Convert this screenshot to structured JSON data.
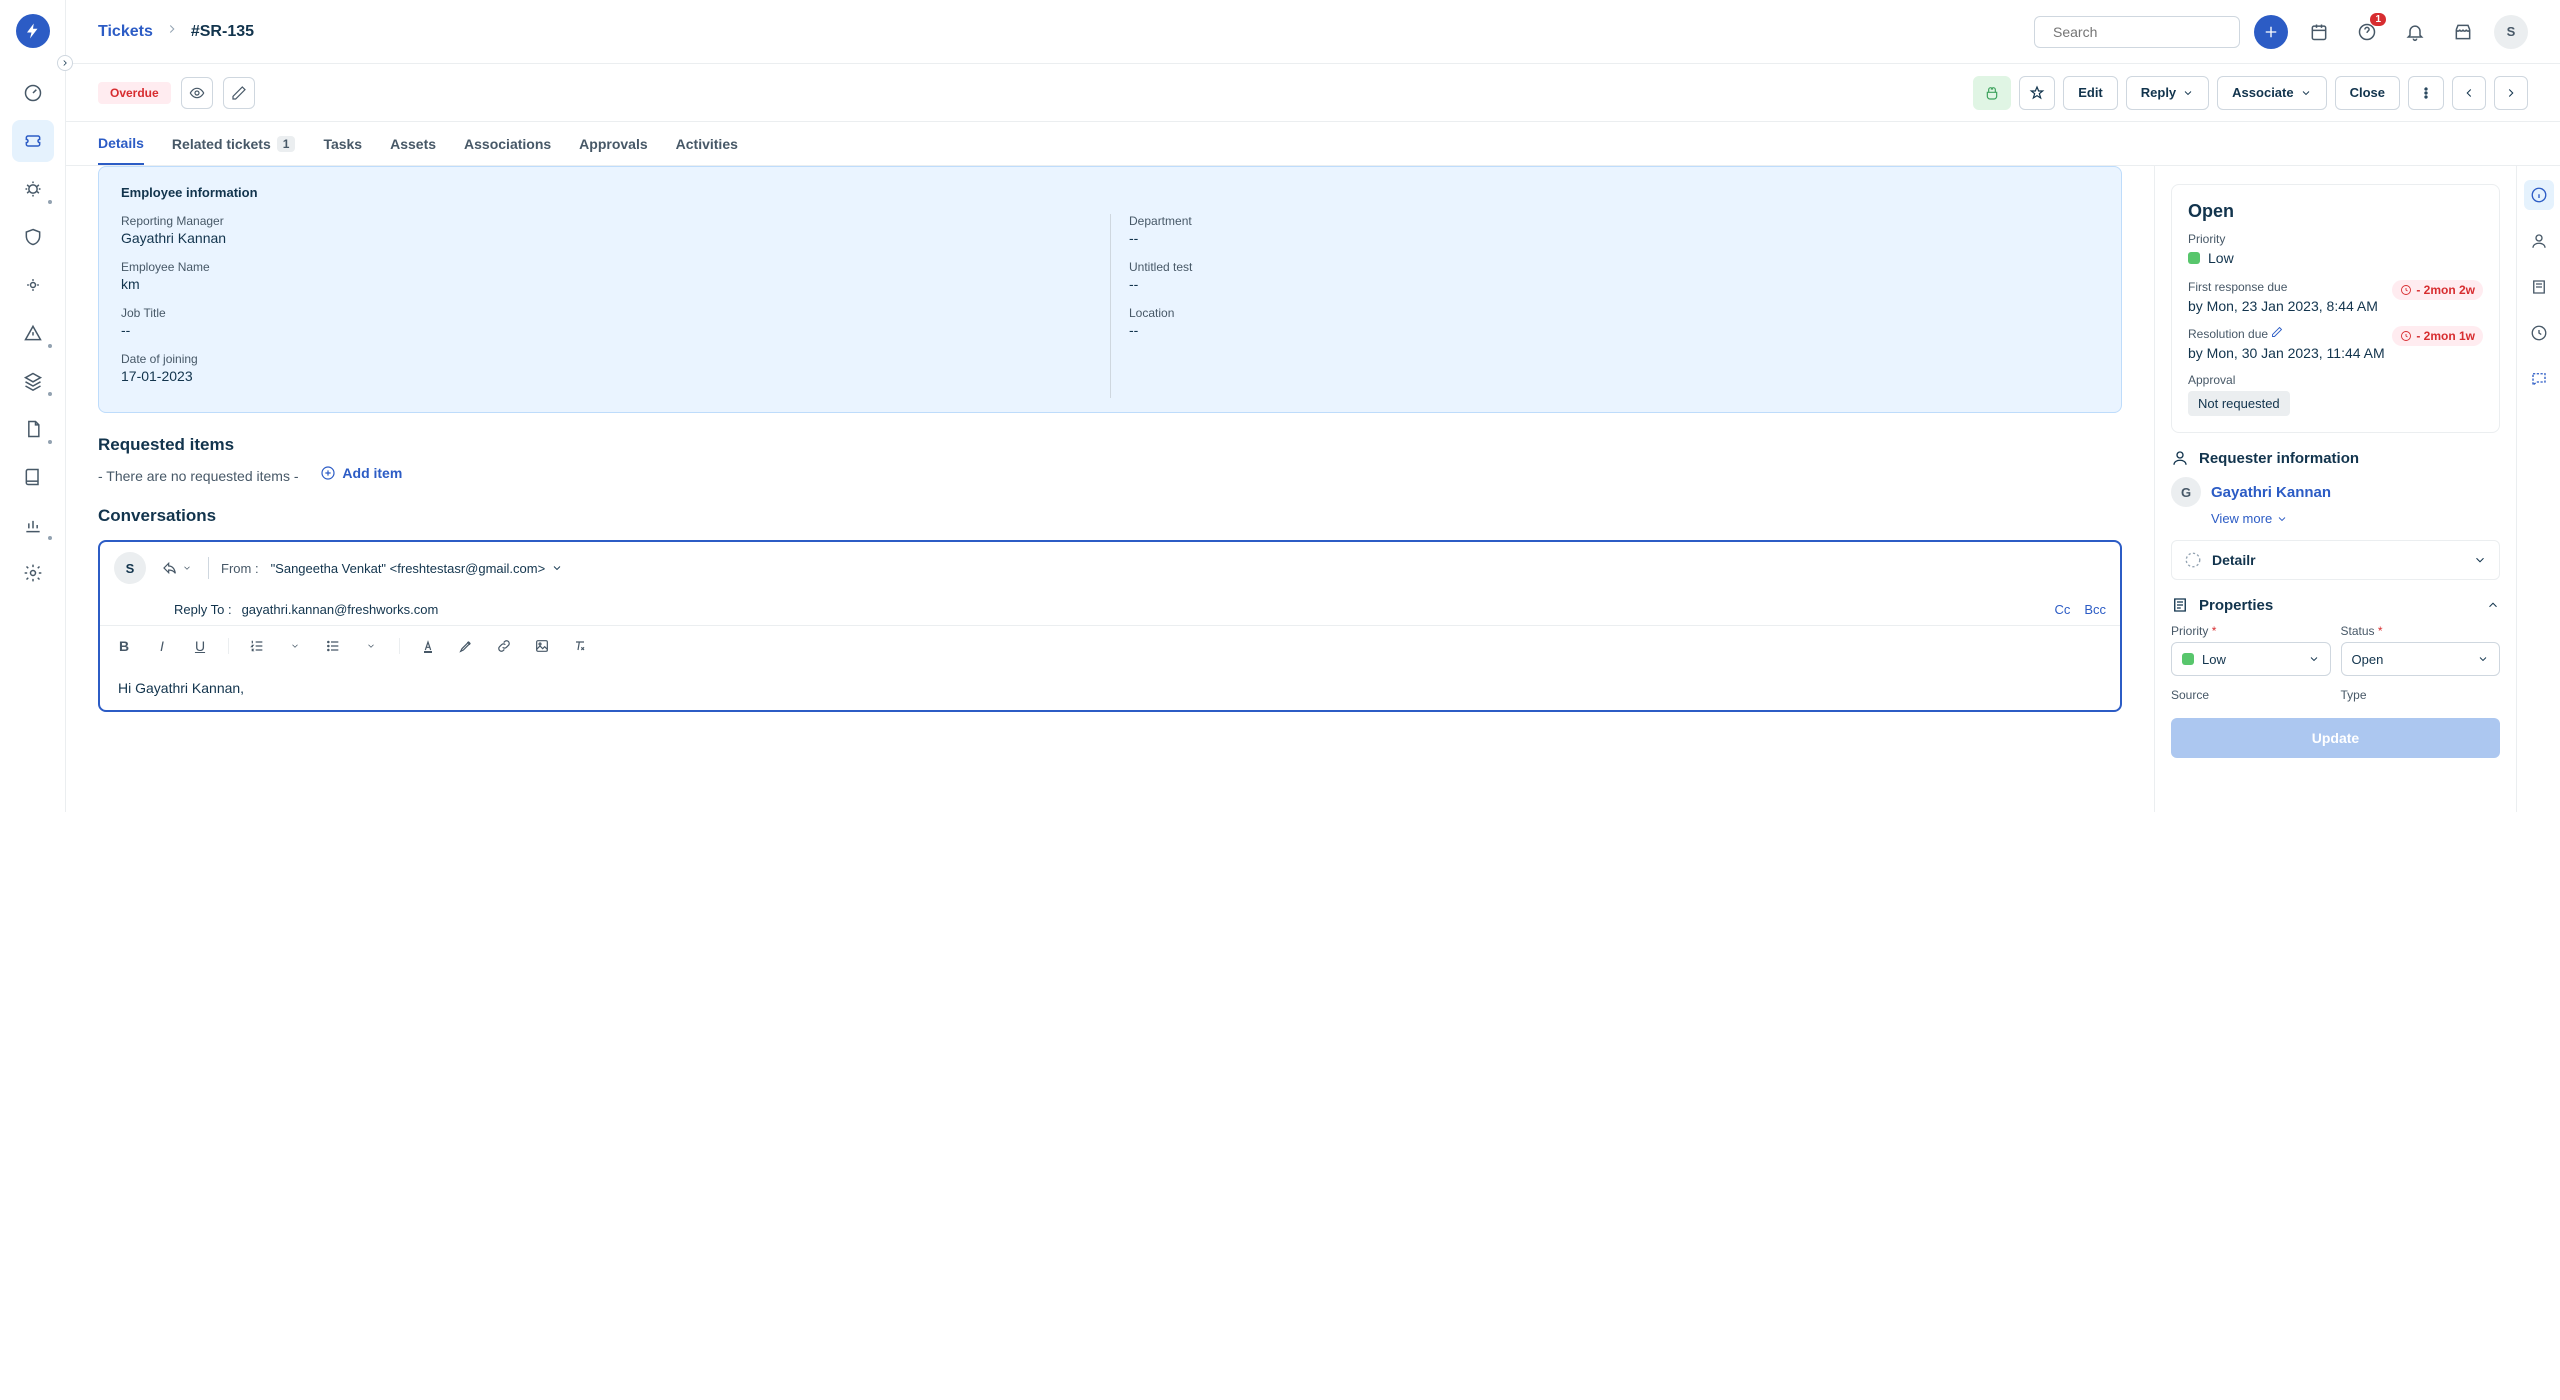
{
  "breadcrumb": {
    "root": "Tickets",
    "current": "#SR-135"
  },
  "search": {
    "placeholder": "Search"
  },
  "notif_count": "1",
  "avatar_initial": "S",
  "badges": {
    "overdue": "Overdue"
  },
  "actions": {
    "edit": "Edit",
    "reply": "Reply",
    "associate": "Associate",
    "close": "Close"
  },
  "tabs": {
    "details": "Details",
    "related": "Related tickets",
    "related_count": "1",
    "tasks": "Tasks",
    "assets": "Assets",
    "associations": "Associations",
    "approvals": "Approvals",
    "activities": "Activities"
  },
  "employee_info": {
    "title": "Employee information",
    "reporting_manager_label": "Reporting Manager",
    "reporting_manager": "Gayathri Kannan",
    "department_label": "Department",
    "department": "--",
    "employee_name_label": "Employee Name",
    "employee_name": "km",
    "untitled_label": "Untitled test",
    "untitled": "--",
    "job_title_label": "Job Title",
    "job_title": "--",
    "location_label": "Location",
    "location": "--",
    "doj_label": "Date of joining",
    "doj": "17-01-2023"
  },
  "requested": {
    "title": "Requested items",
    "empty": "- There are no requested items -",
    "add": "Add item"
  },
  "conversations": {
    "title": "Conversations"
  },
  "composer": {
    "avatar": "S",
    "from_label": "From :",
    "from_value": "\"Sangeetha Venkat\" <freshtestasr@gmail.com>",
    "reply_to_label": "Reply To :",
    "reply_to_value": "gayathri.kannan@freshworks.com",
    "cc": "Cc",
    "bcc": "Bcc",
    "body": "Hi Gayathri Kannan,"
  },
  "side": {
    "status": "Open",
    "priority_label": "Priority",
    "priority_value": "Low",
    "first_response_label": "First response due",
    "first_response_value": "by Mon, 23 Jan 2023, 8:44 AM",
    "first_response_overdue": "- 2mon 2w",
    "resolution_label": "Resolution due",
    "resolution_value": "by Mon, 30 Jan 2023, 11:44 AM",
    "resolution_overdue": "- 2mon 1w",
    "approval_label": "Approval",
    "approval_value": "Not requested",
    "requester_title": "Requester information",
    "requester_initial": "G",
    "requester_name": "Gayathri Kannan",
    "view_more": "View more",
    "detailr": "Detailr",
    "properties_title": "Properties",
    "prio_field_label": "Priority",
    "prio_field_value": "Low",
    "status_field_label": "Status",
    "status_field_value": "Open",
    "source_label": "Source",
    "type_label": "Type",
    "update": "Update"
  }
}
